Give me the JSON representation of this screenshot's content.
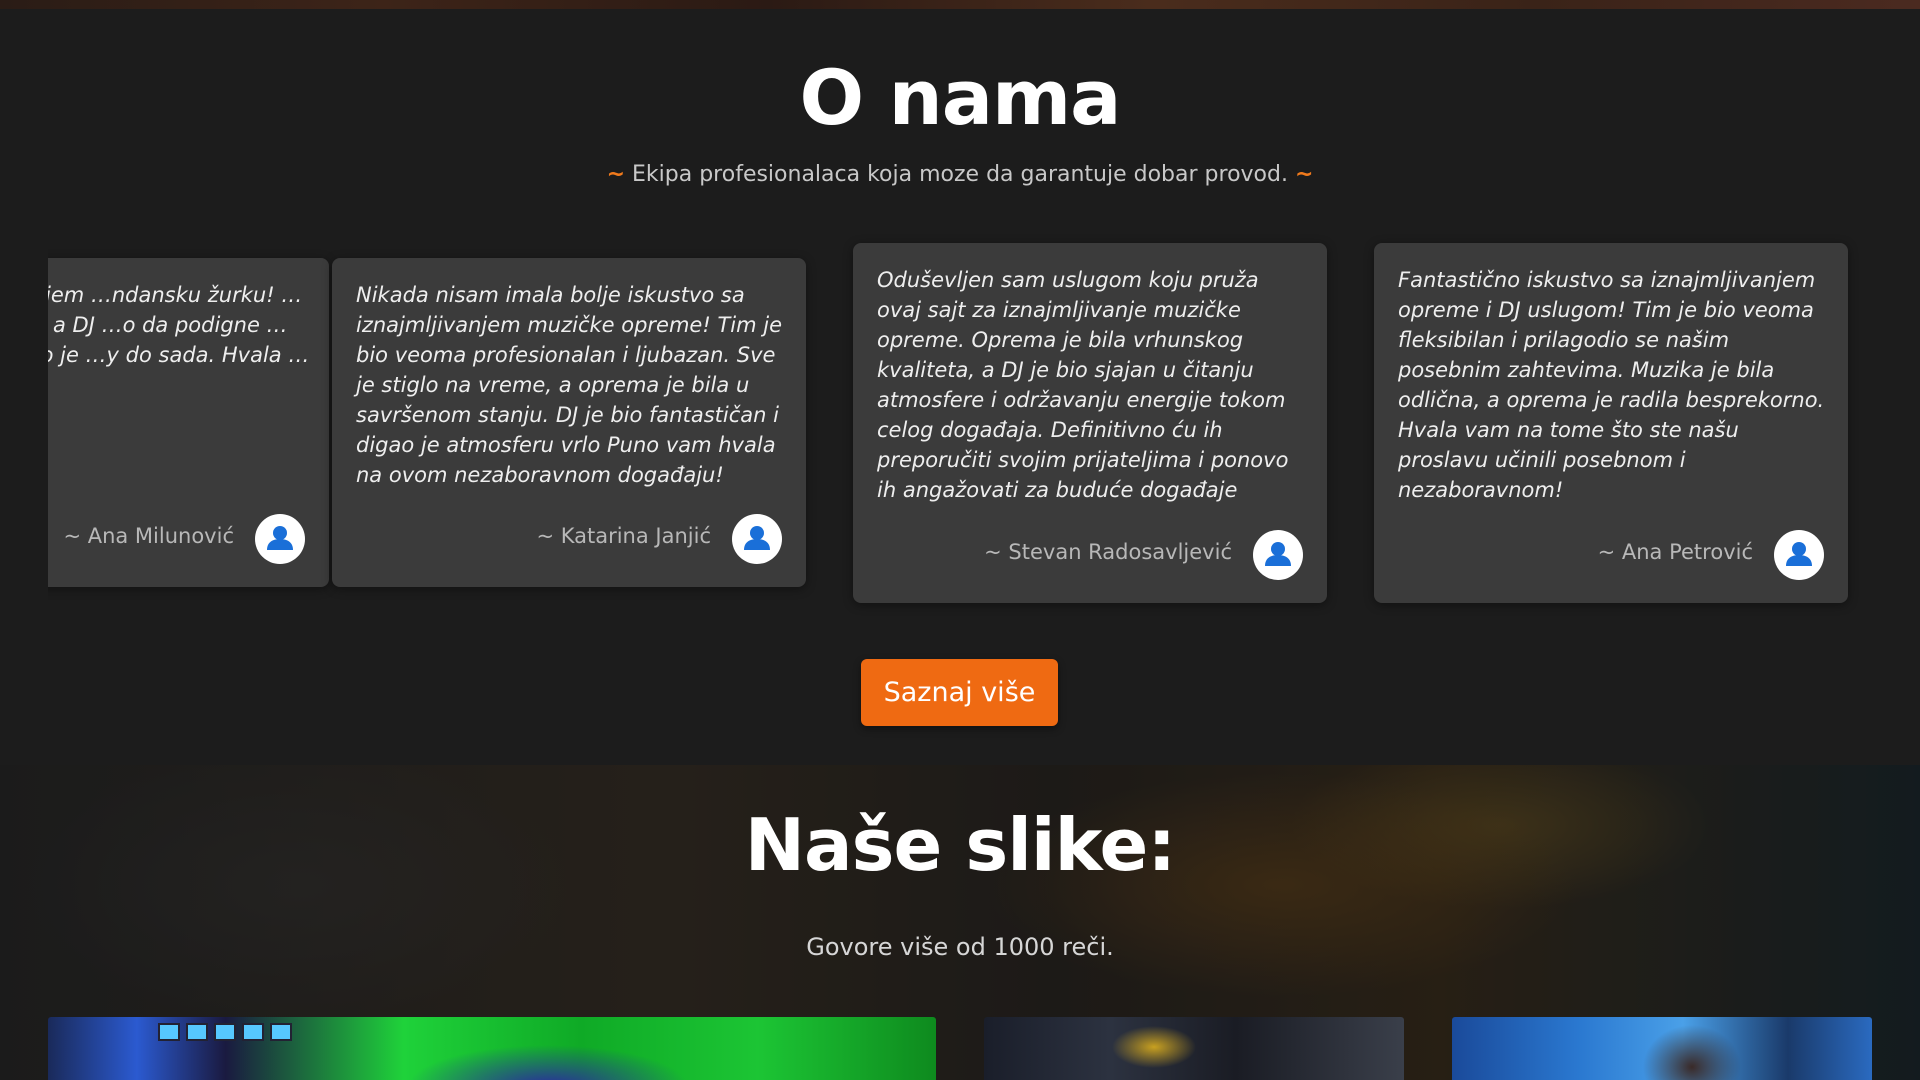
{
  "about": {
    "title": "O nama",
    "subtitle_tilde_left": "~",
    "subtitle": "Ekipa profesionalaca koja moze da garantuje dobar provod.",
    "subtitle_tilde_right": "~"
  },
  "testimonials": [
    {
      "text": "…a iznajmljivanjem …ndansku žurku! …nskog kvaliteta, a DJ …o da podigne …mentarisali kako je …y do sada. Hvala …visu",
      "author": "~ Ana Milunović",
      "avatar_icon": "user-avatar-icon"
    },
    {
      "text": "Nikada nisam imala bolje iskustvo sa iznajmljivanjem muzičke opreme! Tim je bio veoma profesionalan i ljubazan. Sve je stiglo na vreme, a oprema je bila u savršenom stanju. DJ je bio fantastičan i digao je atmosferu vrlo Puno vam hvala na ovom nezaboravnom događaju!",
      "author": "~ Katarina Janjić",
      "avatar_icon": "user-avatar-icon"
    },
    {
      "text": "Oduševljen sam uslugom koju pruža ovaj sajt za iznajmljivanje muzičke opreme. Oprema je bila vrhunskog kvaliteta, a DJ je bio sjajan u čitanju atmosfere i održavanju energije tokom celog događaja. Definitivno ću ih preporučiti svojim prijateljima i ponovo ih angažovati za buduće događaje",
      "author": "~ Stevan Radosavljević",
      "avatar_icon": "user-avatar-icon"
    },
    {
      "text": "Fantastično iskustvo sa iznajmljivanjem opreme i DJ uslugom! Tim je bio veoma fleksibilan i prilagodio se našim posebnim zahtevima. Muzika je bila odlična, a oprema je radila besprekorno. Hvala vam na tome što ste našu proslavu učinili posebnom i nezaboravnom!",
      "author": "~ Ana Petrović",
      "avatar_icon": "user-avatar-icon"
    }
  ],
  "cta": {
    "label": "Saznaj više"
  },
  "photos": {
    "title": "Naše slike:",
    "subtitle": "Govore više od 1000 reči."
  },
  "colors": {
    "accent": "#ef6a12",
    "card_bg": "#3b3b3b",
    "section_bg": "#1c1c1c",
    "avatar_blue": "#1a6fd8"
  }
}
